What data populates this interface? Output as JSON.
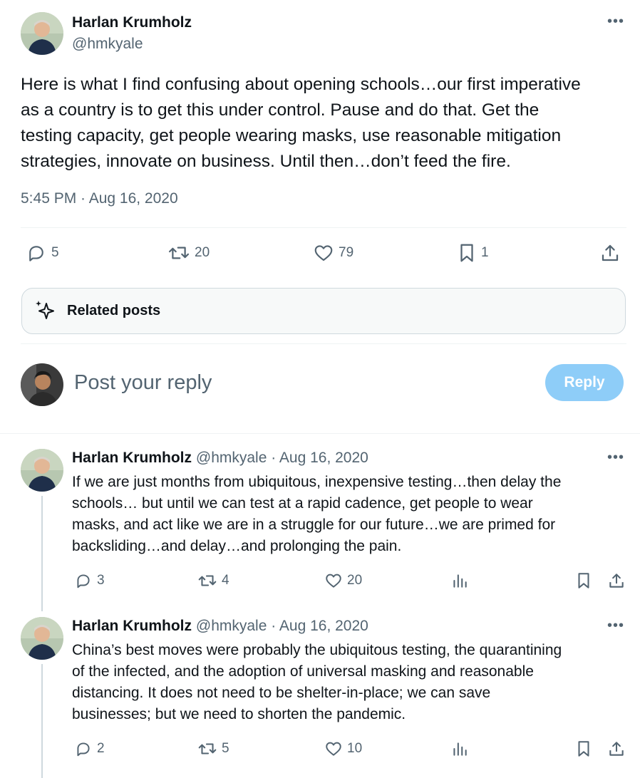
{
  "main_post": {
    "author_name": "Harlan Krumholz",
    "author_handle": "@hmkyale",
    "text_lines": [
      "Here is what I find confusing about opening schools…our first imperative",
      "as a country is to get this under control. Pause and do that. Get the",
      "testing capacity, get people wearing masks, use reasonable mitigation",
      "strategies, innovate on business. Until then…don’t feed the fire."
    ],
    "timestamp": "5:45 PM · Aug 16, 2020",
    "replies": "5",
    "reposts": "20",
    "likes": "79",
    "bookmarks": "1"
  },
  "related": {
    "label": "Related posts"
  },
  "composer": {
    "placeholder": "Post your reply",
    "button_label": "Reply"
  },
  "replies": [
    {
      "author_name": "Harlan Krumholz",
      "meta": "@hmkyale · Aug 16, 2020",
      "text_lines": [
        "If we are just months from ubiquitous, inexpensive testing…then delay the",
        "schools… but until we can test at a rapid cadence, get people to wear",
        "masks, and act like we are in a struggle for our future…we are primed for",
        "backsliding…and delay…and prolonging the pain."
      ],
      "replies": "3",
      "reposts": "4",
      "likes": "20"
    },
    {
      "author_name": "Harlan Krumholz",
      "meta": "@hmkyale · Aug 16, 2020",
      "text_lines": [
        "China’s best moves were probably the ubiquitous testing, the quarantining",
        "of the infected, and the adoption of universal masking and reasonable",
        "distancing. It does not need to be shelter-in-place; we can save",
        "businesses; but we need to shorten the pandemic."
      ],
      "replies": "2",
      "reposts": "5",
      "likes": "10"
    }
  ],
  "colors": {
    "text": "#0f1419",
    "secondary": "#536471",
    "reply_button": "#8ecdf8",
    "divider": "#eff3f4"
  },
  "icons": [
    "more-icon",
    "reply-icon",
    "repost-icon",
    "like-icon",
    "bookmark-icon",
    "share-icon",
    "sparkle-icon",
    "views-icon"
  ]
}
